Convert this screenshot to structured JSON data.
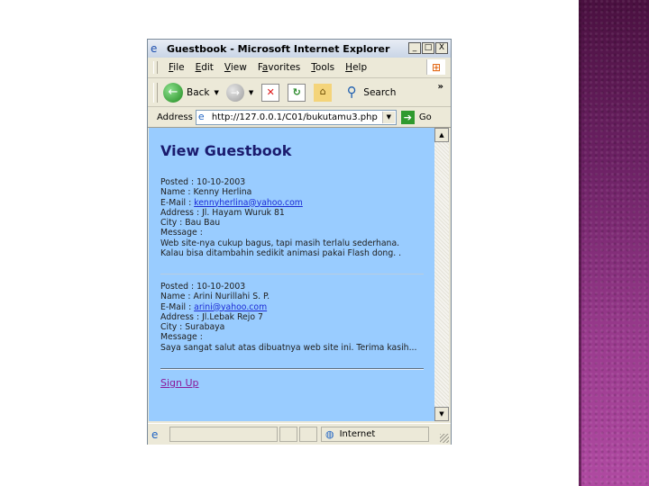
{
  "window": {
    "title": "Guestbook - Microsoft Internet Explorer",
    "controls": [
      "_",
      "□",
      "X"
    ]
  },
  "menubar": {
    "items": [
      {
        "first": "F",
        "rest": "ile"
      },
      {
        "first": "E",
        "rest": "dit"
      },
      {
        "first": "V",
        "rest": "iew"
      },
      {
        "first": "F",
        "rest": "a",
        "after": "vorites",
        "underline_index": 1
      },
      {
        "first": "T",
        "rest": "ools"
      },
      {
        "first": "H",
        "rest": "elp"
      }
    ]
  },
  "toolbar": {
    "back_label": "Back",
    "search_label": "Search",
    "overflow": "»"
  },
  "address": {
    "label": "Address",
    "url": "http://127.0.0.1/C01/bukutamu3.php",
    "go_label": "Go"
  },
  "page": {
    "heading": "View Guestbook",
    "entries": [
      {
        "posted": "Posted : 10-10-2003",
        "name": "Name : Kenny Herlina",
        "email_prefix": "E-Mail : ",
        "email": "kennyherlina@yahoo.com",
        "address": "Address : Jl. Hayam Wuruk 81",
        "city": "City : Bau Bau",
        "message_label": "Message :",
        "message": "Web site-nya cukup bagus, tapi masih terlalu sederhana. Kalau bisa ditambahin sedikit animasi pakai Flash dong. ."
      },
      {
        "posted": "Posted : 10-10-2003",
        "name": "Name : Arini Nurillahi S. P.",
        "email_prefix": "E-Mail : ",
        "email": "arini@yahoo.com",
        "address": "Address : Jl.Lebak Rejo 7",
        "city": "City : Surabaya",
        "message_label": "Message :",
        "message": "Saya sangat salut atas dibuatnya web site ini. Terima kasih..."
      }
    ],
    "signup_link": "Sign Up"
  },
  "statusbar": {
    "zone": "Internet"
  },
  "colors": {
    "content_bg": "#99ccff",
    "heading": "#1b1b6e",
    "link": "#1b2bd6",
    "visited_link": "#8a1a9a",
    "chrome": "#ece9d8",
    "side_band": "#6a1e62"
  }
}
